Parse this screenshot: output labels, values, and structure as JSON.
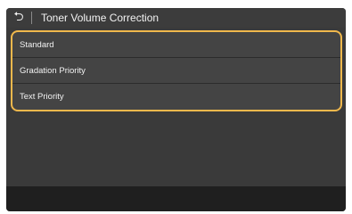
{
  "header": {
    "back_icon": "back-arrow-icon",
    "back_glyph": "⮌",
    "title": "Toner Volume Correction"
  },
  "options": [
    {
      "label": "Standard"
    },
    {
      "label": "Gradation Priority"
    },
    {
      "label": "Text Priority"
    }
  ],
  "colors": {
    "panel_bg": "#3a3a3a",
    "selection_border": "#f0b84c",
    "text": "#f2f2f2",
    "footer_bg": "#1f1f1f"
  }
}
